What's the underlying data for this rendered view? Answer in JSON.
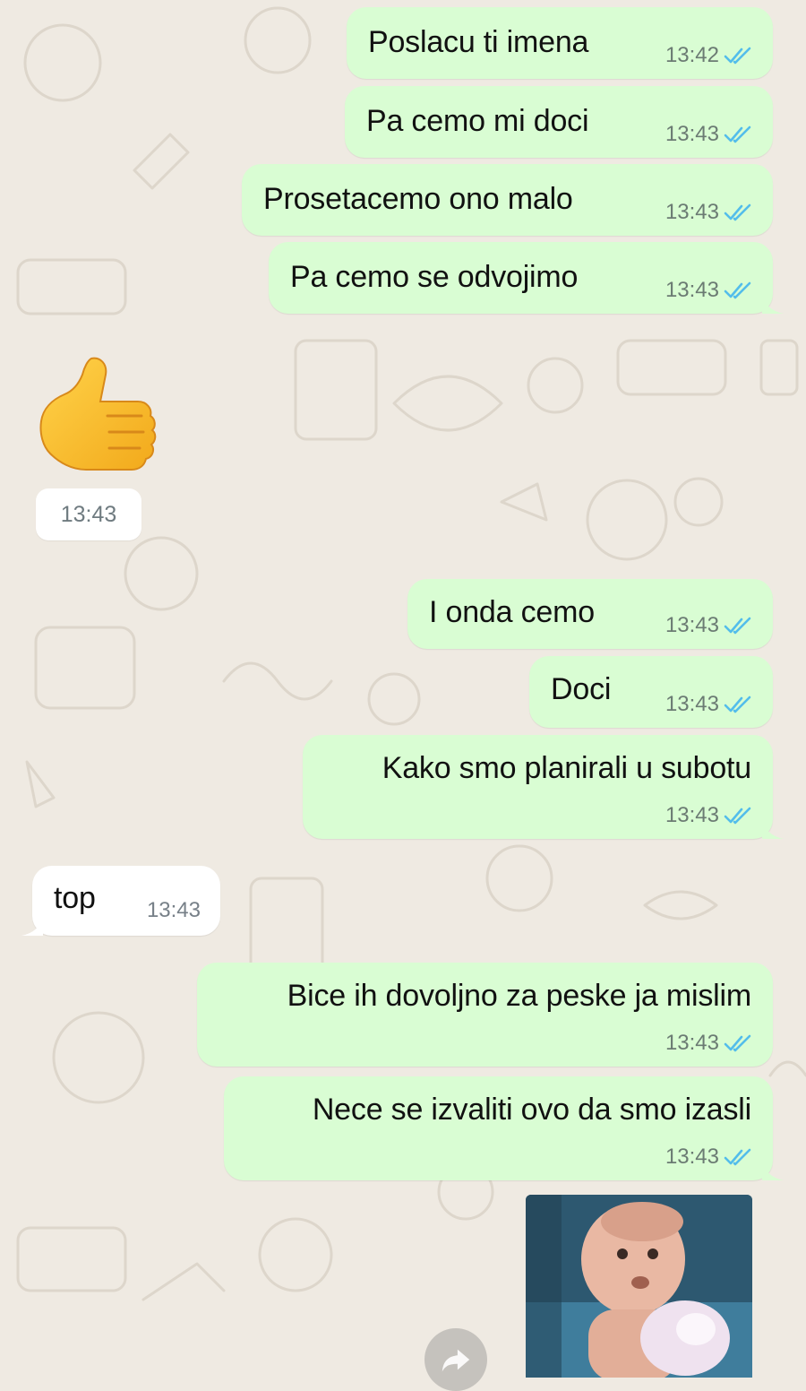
{
  "colors": {
    "outgoing_bubble": "#d9fdd3",
    "incoming_bubble": "#ffffff",
    "read_ticks": "#53bdeb",
    "wallpaper": "#efeae2"
  },
  "messages": [
    {
      "direction": "out",
      "text": "Poslacu ti imena",
      "time": "13:42",
      "status": "read"
    },
    {
      "direction": "out",
      "text": "Pa cemo mi doci",
      "time": "13:43",
      "status": "read"
    },
    {
      "direction": "out",
      "text": "Prosetacemo ono malo",
      "time": "13:43",
      "status": "read"
    },
    {
      "direction": "out",
      "text": "Pa cemo se odvojimo",
      "time": "13:43",
      "status": "read"
    },
    {
      "direction": "in",
      "type": "emoji",
      "emoji": "thumbs-up",
      "time": "13:43"
    },
    {
      "direction": "out",
      "text": "I onda cemo",
      "time": "13:43",
      "status": "read"
    },
    {
      "direction": "out",
      "text": "Doci",
      "time": "13:43",
      "status": "read"
    },
    {
      "direction": "out",
      "text": "Kako smo planirali u subotu",
      "time": "13:43",
      "status": "read"
    },
    {
      "direction": "in",
      "text": "top",
      "time": "13:43"
    },
    {
      "direction": "out",
      "text": "Bice ih dovoljno za peske ja mislim",
      "time": "13:43",
      "status": "read"
    },
    {
      "direction": "out",
      "text": "Nece se izvaliti ovo da smo izasli",
      "time": "13:43",
      "status": "read"
    },
    {
      "direction": "out",
      "type": "video",
      "thumbnail": "baby-video-thumbnail"
    }
  ],
  "icons": {
    "read_receipt": "double-check-icon",
    "forward": "forward-icon",
    "emoji": "thumbs-up-icon"
  }
}
